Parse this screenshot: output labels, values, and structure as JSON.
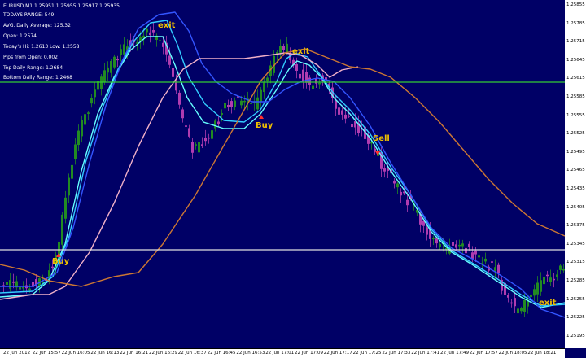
{
  "chart": {
    "symbol_line": "EURUSD,M1  1.25951 1.25955 1.25917 1.25935",
    "info_lines": [
      "TODAYS RANGE: 549",
      "AVG. Daily Average: 125.32",
      "Open: 1.2574",
      "Today's Hi: 1.2613   Low: 1.2558",
      "Pips from Open: 0.002",
      "Top Daily Range: 1.2684",
      "Bottom Daily Range: 1.2468"
    ]
  },
  "price_axis": {
    "labels": [
      "1.25855",
      "1.25785",
      "1.25715",
      "1.25645",
      "1.25615",
      "1.25585",
      "1.25555",
      "1.25525",
      "1.25495",
      "1.25465",
      "1.25435",
      "1.25405",
      "1.25375",
      "1.25345",
      "1.25315",
      "1.25285",
      "1.25255",
      "1.25225",
      "1.25195"
    ]
  },
  "time_axis": {
    "labels": [
      "22 Jun 2012",
      "22 Jun 15:57",
      "22 Jun 16:05",
      "22 Jun 16:13",
      "22 Jun 16:21",
      "22 Jun 16:29",
      "22 Jun 16:37",
      "22 Jun 16:45",
      "22 Jun 16:53",
      "22 Jun 17:01",
      "22 Jun 17:09",
      "22 Jun 17:17",
      "22 Jun 17:25",
      "22 Jun 17:33",
      "22 Jun 17:41",
      "22 Jun 17:49",
      "22 Jun 17:57",
      "22 Jun 18:05",
      "22 Jun 18:21"
    ]
  },
  "annotations": [
    {
      "text": "exit",
      "kind": "exit"
    },
    {
      "text": "exit",
      "kind": "exit"
    },
    {
      "text": "Buy",
      "kind": "buy"
    },
    {
      "text": "Sell",
      "kind": "sell"
    },
    {
      "text": "Buy",
      "kind": "buy"
    },
    {
      "text": "exit",
      "kind": "exit"
    }
  ],
  "colors": {
    "background": "#000066",
    "bull_candle": "#228b22",
    "bear_candle": "#b03cb0",
    "top_range_line": "#33cc33",
    "bottom_range_line": "#e0e0e0",
    "ma_cyan": "#33ccff",
    "ma_light_cyan": "#66ffff",
    "ma_blue": "#3355ff",
    "ma_pink": "#f0b0c8",
    "ma_orange": "#cc7733",
    "annotation_text": "#f0c000"
  }
}
